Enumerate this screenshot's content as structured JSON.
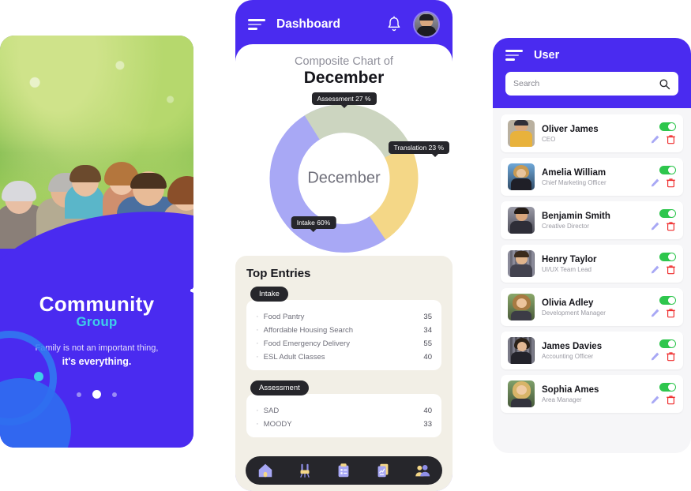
{
  "onboarding": {
    "brand_main": "Community",
    "brand_sub": "Group",
    "tagline_line1": "Family is not an important thing,",
    "tagline_line2": "it's everything.",
    "photo_alt": "family-photo",
    "dots_total": 3,
    "active_dot": 2,
    "colors": {
      "purple": "#4a2bf0",
      "cyan": "#3ed0e8",
      "blue": "#2f6ef0"
    }
  },
  "dashboard": {
    "header": {
      "menu_icon": "hamburger-icon",
      "title": "Dashboard",
      "bell_icon": "bell-icon",
      "avatar": "user-avatar"
    },
    "chart_heading_small": "Composite Chart of",
    "chart_heading_large": "December",
    "chart_data": {
      "type": "pie",
      "title": "Composite Chart of December",
      "center_label": "December",
      "categories": [
        "Intake",
        "Assessment",
        "Translation"
      ],
      "values": [
        60,
        27,
        23
      ],
      "unit": "%",
      "colors": [
        "#a8a8f5",
        "#ccd5c0",
        "#f4d787"
      ],
      "labels": [
        "Intake 60%",
        "Assessment  27 %",
        "Translation  23 %"
      ],
      "legend_position": "below",
      "donut": true
    },
    "stats": [
      {
        "label": "Intake",
        "value": "60%",
        "pct": 60,
        "color": "#a8a8f5"
      },
      {
        "label": "Assessment",
        "value": "27%",
        "pct": 55,
        "color": "#ccd5c0"
      },
      {
        "label": "Translation",
        "value": "23%",
        "pct": 58,
        "color": "#f4d787"
      }
    ],
    "entries_title": "Top Entries",
    "entry_groups": [
      {
        "chip": "Intake",
        "rows": [
          {
            "name": "Food Pantry",
            "value": "35"
          },
          {
            "name": "Affordable Housing Search",
            "value": "34"
          },
          {
            "name": "Food Emergency Delivery",
            "value": "55"
          },
          {
            "name": "ESL Adult Classes",
            "value": "40"
          }
        ]
      },
      {
        "chip": "Assessment",
        "rows": [
          {
            "name": "SAD",
            "value": "40"
          },
          {
            "name": "MOODY",
            "value": "33"
          }
        ]
      }
    ],
    "nav_items": [
      {
        "icon": "home-icon",
        "active": true
      },
      {
        "icon": "device-icon",
        "active": false
      },
      {
        "icon": "clipboard-list-icon",
        "active": false
      },
      {
        "icon": "report-chart-icon",
        "active": false
      },
      {
        "icon": "users-icon",
        "active": false
      }
    ]
  },
  "users_screen": {
    "menu_icon": "hamburger-icon",
    "title": "User",
    "search": {
      "value": "",
      "placeholder": "Search",
      "icon": "search-icon"
    },
    "rows": [
      {
        "name": "Oliver James",
        "role": "CEO",
        "enabled": true,
        "av1": "#e8b23c",
        "av2": "#3a3a46"
      },
      {
        "name": "Amelia William",
        "role": "Chief Marketing Officer",
        "enabled": true,
        "av1": "#5f9ad6",
        "av2": "#2b2b36"
      },
      {
        "name": "Benjamin Smith",
        "role": "Creative Director",
        "enabled": true,
        "av1": "#7d7d8c",
        "av2": "#2e2e38"
      },
      {
        "name": "Henry Taylor",
        "role": "UI/UX Team Lead",
        "enabled": true,
        "av1": "#8a8a99",
        "av2": "#43434f"
      },
      {
        "name": "Olivia Adley",
        "role": "Development Manager",
        "enabled": true,
        "av1": "#7e9a5e",
        "av2": "#3c3c46"
      },
      {
        "name": "James Davies",
        "role": "Accounting Officer",
        "enabled": true,
        "av1": "#6b6b78",
        "av2": "#27272f"
      },
      {
        "name": "Sophia Ames",
        "role": "Area Manager",
        "enabled": true,
        "av1": "#6f9a63",
        "av2": "#33333d"
      }
    ],
    "row_actions": {
      "edit_icon": "pencil-icon",
      "delete_icon": "trash-icon",
      "toggle": "status-toggle"
    }
  }
}
